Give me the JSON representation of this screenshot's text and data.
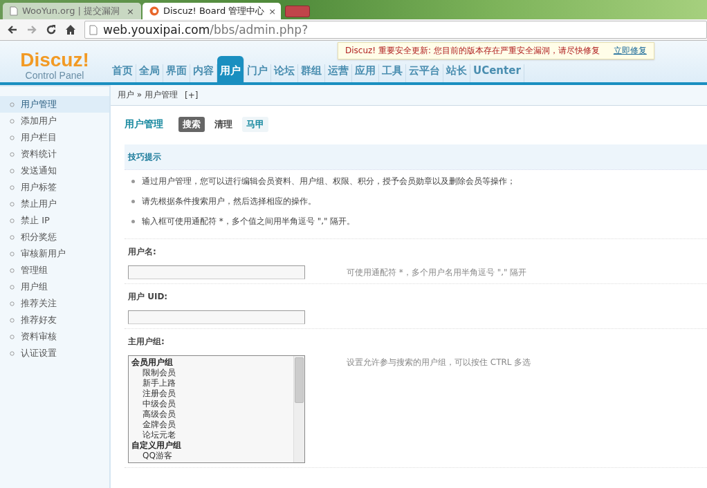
{
  "browser": {
    "tabs": [
      {
        "title": "WooYun.org | 提交漏洞",
        "selected": false
      },
      {
        "title": "Discuz! Board 管理中心",
        "selected": true
      }
    ],
    "close_label": "×",
    "url": {
      "host": "web.youxipai.com",
      "path": "/bbs/admin.php?"
    }
  },
  "header": {
    "logo": "Discuz!",
    "logo_sub": "Control Panel",
    "nav": [
      {
        "label": "首页",
        "selected": false
      },
      {
        "label": "全局",
        "selected": false
      },
      {
        "label": "界面",
        "selected": false
      },
      {
        "label": "内容",
        "selected": false
      },
      {
        "label": "用户",
        "selected": true
      },
      {
        "label": "门户",
        "selected": false
      },
      {
        "label": "论坛",
        "selected": false
      },
      {
        "label": "群组",
        "selected": false
      },
      {
        "label": "运营",
        "selected": false
      },
      {
        "label": "应用",
        "selected": false
      },
      {
        "label": "工具",
        "selected": false
      },
      {
        "label": "云平台",
        "selected": false
      },
      {
        "label": "站长",
        "selected": false
      },
      {
        "label": "UCenter",
        "selected": false
      }
    ],
    "notice": {
      "text": "Discuz! 重要安全更新: 您目前的版本存在严重安全漏洞，请尽快修复",
      "link": "立即修复"
    }
  },
  "breadcrumb": {
    "path": "用户 » 用户管理",
    "add": "[+]"
  },
  "sidebar": {
    "items": [
      {
        "label": "用户管理",
        "selected": true
      },
      {
        "label": "添加用户",
        "selected": false
      },
      {
        "label": "用户栏目",
        "selected": false
      },
      {
        "label": "资料统计",
        "selected": false
      },
      {
        "label": "发送通知",
        "selected": false
      },
      {
        "label": "用户标签",
        "selected": false
      },
      {
        "label": "禁止用户",
        "selected": false
      },
      {
        "label": "禁止 IP",
        "selected": false
      },
      {
        "label": "积分奖惩",
        "selected": false
      },
      {
        "label": "审核新用户",
        "selected": false
      },
      {
        "label": "管理组",
        "selected": false
      },
      {
        "label": "用户组",
        "selected": false
      },
      {
        "label": "推荐关注",
        "selected": false
      },
      {
        "label": "推荐好友",
        "selected": false
      },
      {
        "label": "资料审核",
        "selected": false
      },
      {
        "label": "认证设置",
        "selected": false
      }
    ]
  },
  "page": {
    "title": "用户管理",
    "subtabs": [
      {
        "label": "搜索",
        "selected": true,
        "kind": "normal"
      },
      {
        "label": "清理",
        "selected": false,
        "kind": "normal"
      },
      {
        "label": "马甲",
        "selected": false,
        "kind": "plugin"
      }
    ],
    "tips": {
      "title": "技巧提示",
      "items": [
        "通过用户管理，您可以进行编辑会员资料、用户组、权限、积分，授予会员勋章以及删除会员等操作；",
        "请先根据条件搜索用户，然后选择相应的操作。",
        "输入框可使用通配符 *，多个值之间用半角逗号 \",\" 隔开。"
      ]
    },
    "fields": [
      {
        "kind": "text",
        "label": "用户名:",
        "hint": "可使用通配符 *，多个用户名用半角逗号 \",\" 隔开"
      },
      {
        "kind": "text",
        "label": "用户 UID:"
      },
      {
        "kind": "listbox",
        "label": "主用户组:",
        "hint": "设置允许参与搜索的用户组，可以按住 CTRL 多选",
        "groups": [
          {
            "label": "会员用户组",
            "options": [
              "限制会员",
              "新手上路",
              "注册会员",
              "中级会员",
              "高级会员",
              "金牌会员",
              "论坛元老"
            ]
          },
          {
            "label": "自定义用户组",
            "options": [
              "QQ游客"
            ]
          }
        ]
      }
    ]
  }
}
